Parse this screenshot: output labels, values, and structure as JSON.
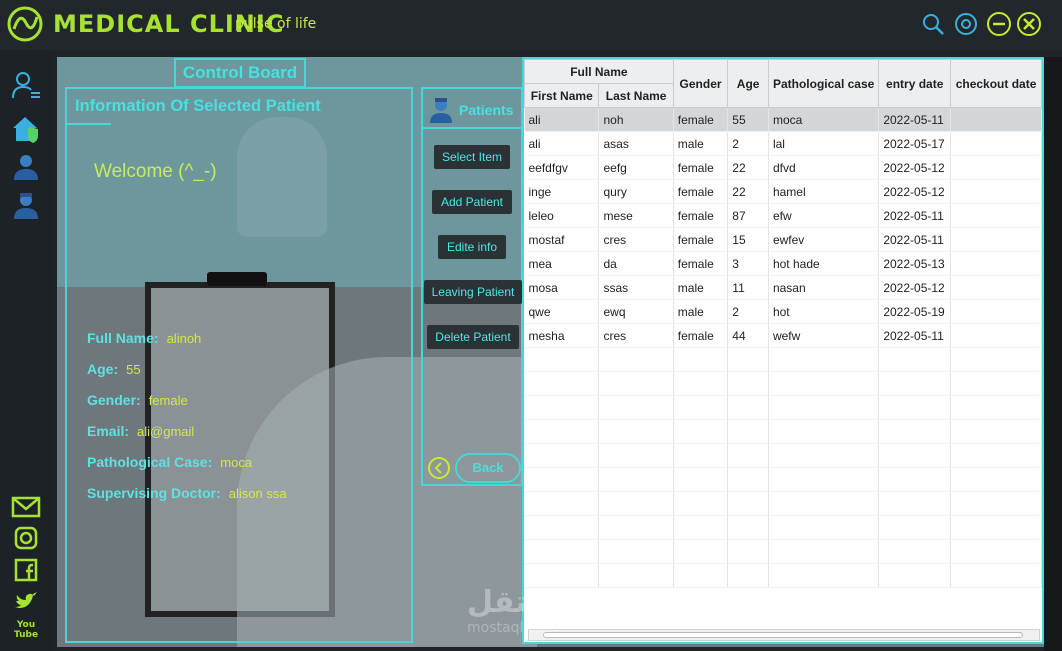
{
  "app": {
    "title": "MEDICAL CLINIC",
    "tagline": "pulse of life"
  },
  "header_buttons": [
    "search-icon",
    "gear-icon",
    "minimize-icon",
    "close-icon"
  ],
  "sidebar": {
    "top_icons": [
      "user-list-icon",
      "home-shield-icon",
      "patient-icon",
      "doctor-icon"
    ],
    "bottom_icons": [
      "mail-icon",
      "instagram-icon",
      "facebook-icon",
      "twitter-icon",
      "youtube-icon"
    ],
    "youtube_label": "You Tube"
  },
  "control_board": {
    "label": "Control Board"
  },
  "info_panel": {
    "title": "Information Of Selected Patient",
    "welcome": "Welcome (^_-)",
    "fields": [
      {
        "label": "Full Name:",
        "value": "alinoh"
      },
      {
        "label": "Age:",
        "value": "55"
      },
      {
        "label": "Gender:",
        "value": "female"
      },
      {
        "label": "Email:",
        "value": "ali@gmail"
      },
      {
        "label": "Pathological Case:",
        "value": "moca"
      },
      {
        "label": "Supervising Doctor:",
        "value": "alison ssa"
      }
    ]
  },
  "patients_panel": {
    "title": "Patients",
    "buttons": [
      "Select Item",
      "Add Patient",
      "Edite info",
      "Leaving Patient",
      "Delete Patient"
    ],
    "back_label": "Back"
  },
  "table": {
    "group_header": "Full Name",
    "columns": [
      "First Name",
      "Last Name",
      "Gender",
      "Age",
      "Pathological case",
      "entry date",
      "checkout date"
    ],
    "rows": [
      [
        "ali",
        "noh",
        "female",
        "55",
        "moca",
        "2022-05-11",
        ""
      ],
      [
        "ali",
        "asas",
        "male",
        "2",
        "lal",
        "2022-05-17",
        ""
      ],
      [
        "eefdfgv",
        "eefg",
        "female",
        "22",
        "dfvd",
        "2022-05-12",
        ""
      ],
      [
        "inge",
        "qury",
        "female",
        "22",
        "hamel",
        "2022-05-12",
        ""
      ],
      [
        "leleo",
        "mese",
        "female",
        "87",
        "efw",
        "2022-05-11",
        ""
      ],
      [
        "mostaf",
        "cres",
        "female",
        "15",
        "ewfev",
        "2022-05-11",
        ""
      ],
      [
        "mea",
        "da",
        "female",
        "3",
        "hot hade",
        "2022-05-13",
        ""
      ],
      [
        "mosa",
        "ssas",
        "male",
        "11",
        "nasan",
        "2022-05-12",
        ""
      ],
      [
        "qwe",
        "ewq",
        "male",
        "2",
        "hot",
        "2022-05-19",
        ""
      ],
      [
        "mesha",
        "cres",
        "female",
        "44",
        "wefw",
        "2022-05-11",
        ""
      ]
    ],
    "selected_row": 0
  },
  "watermark": {
    "main": "مستقل",
    "sub": "mostaql.com"
  },
  "colors": {
    "accent": "#48d6d6",
    "brand": "#a6e22e",
    "value": "#d5e84a"
  }
}
